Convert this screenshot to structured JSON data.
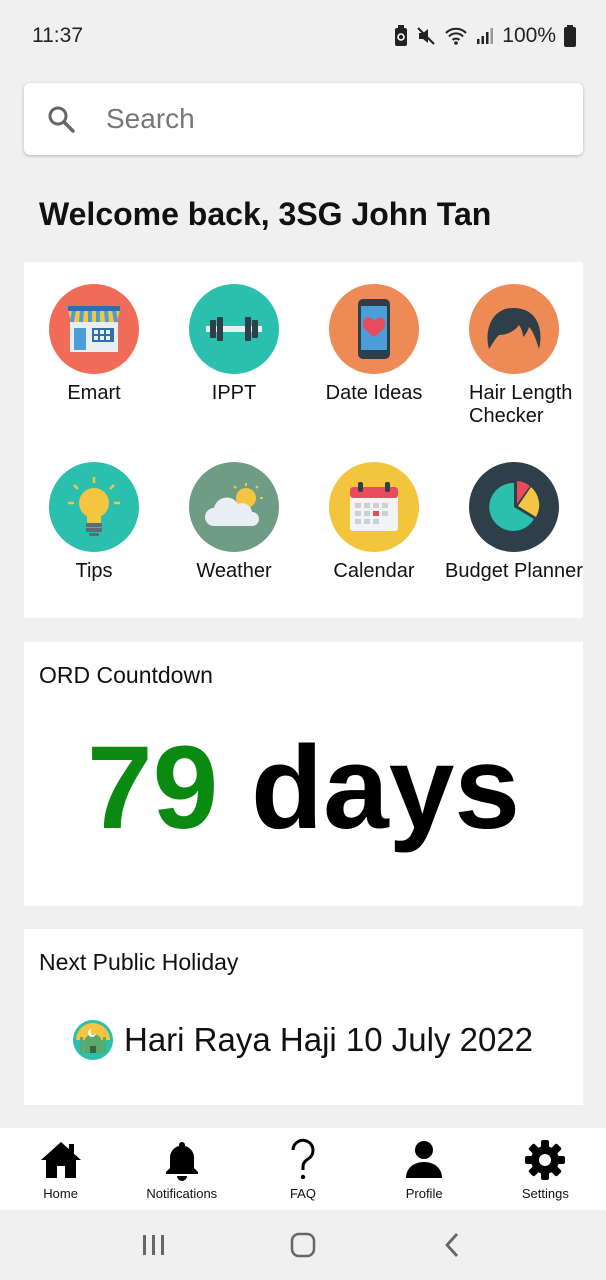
{
  "status_bar": {
    "time": "11:37",
    "battery": "100%"
  },
  "search": {
    "placeholder": "Search",
    "value": ""
  },
  "welcome_text": "Welcome back, 3SG John Tan",
  "apps": [
    {
      "label": "Emart",
      "icon": "store-icon",
      "color": "#f06b58"
    },
    {
      "label": "IPPT",
      "icon": "dumbbell-icon",
      "color": "#2bbfae"
    },
    {
      "label": "Date Ideas",
      "icon": "phone-heart-icon",
      "color": "#ee8a55"
    },
    {
      "label": "Hair Length Checker",
      "icon": "hair-icon",
      "color": "#ee8a55"
    },
    {
      "label": "Tips",
      "icon": "lightbulb-icon",
      "color": "#2bbfae"
    },
    {
      "label": "Weather",
      "icon": "cloud-sun-icon",
      "color": "#6e9c84"
    },
    {
      "label": "Calendar",
      "icon": "calendar-icon",
      "color": "#f2c53d"
    },
    {
      "label": "Budget Planner",
      "icon": "pie-chart-icon",
      "color": "#2f3f4a"
    }
  ],
  "ord": {
    "title": "ORD Countdown",
    "number": "79",
    "unit": "days",
    "number_color": "#0b8a12"
  },
  "holiday": {
    "title": "Next Public Holiday",
    "text": "Hari Raya Haji 10 July 2022"
  },
  "bottom_nav": [
    {
      "label": "Home",
      "icon": "home-icon"
    },
    {
      "label": "Notifications",
      "icon": "bell-icon"
    },
    {
      "label": "FAQ",
      "icon": "question-icon"
    },
    {
      "label": "Profile",
      "icon": "person-icon"
    },
    {
      "label": "Settings",
      "icon": "gear-icon"
    }
  ]
}
